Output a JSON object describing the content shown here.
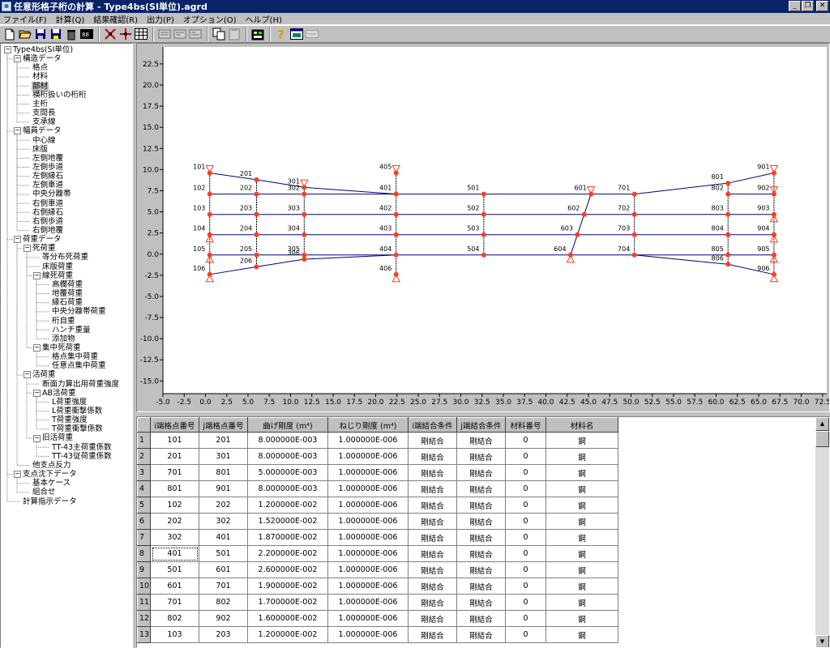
{
  "window": {
    "title": "任意形格子桁の計算 - Type4bs(SI単位).agrd",
    "app_icon": "app-icon",
    "minimize": "_",
    "maximize": "❐",
    "close": "✕"
  },
  "menu": [
    "ファイル(F)",
    "計算(Q)",
    "結果確認(R)",
    "出力(P)",
    "オプション(O)",
    "ヘルプ(H)"
  ],
  "toolbar_icons": [
    "new-file-icon",
    "open-folder-icon",
    "save-icon",
    "save-as-icon",
    "delete-icon",
    "data-table-icon",
    "node-tool-icon",
    "member-tool-icon",
    "grid-view-icon",
    "page-icon-1",
    "page-icon-2",
    "page-icon-3",
    "copy-icon",
    "paste-icon",
    "calculator-icon",
    "help-icon",
    "window-icon",
    "disabled-tool-icon"
  ],
  "tree": [
    {
      "label": "Type4bs(SI単位)",
      "level": 0,
      "expander": "−"
    },
    {
      "label": "構造データ",
      "level": 1,
      "expander": "−"
    },
    {
      "label": "格点",
      "level": 2
    },
    {
      "label": "材料",
      "level": 2
    },
    {
      "label": "部材",
      "level": 2,
      "selected": true
    },
    {
      "label": "横桁扱いの桁桁",
      "level": 2
    },
    {
      "label": "主桁",
      "level": 2
    },
    {
      "label": "支間長",
      "level": 2
    },
    {
      "label": "支承線",
      "level": 2
    },
    {
      "label": "幅員データ",
      "level": 1,
      "expander": "−"
    },
    {
      "label": "中心線",
      "level": 2
    },
    {
      "label": "床版",
      "level": 2
    },
    {
      "label": "左側地覆",
      "level": 2
    },
    {
      "label": "左側歩道",
      "level": 2
    },
    {
      "label": "左側縁石",
      "level": 2
    },
    {
      "label": "左側車道",
      "level": 2
    },
    {
      "label": "中央分離帯",
      "level": 2
    },
    {
      "label": "右側車道",
      "level": 2
    },
    {
      "label": "右側縁石",
      "level": 2
    },
    {
      "label": "右側歩道",
      "level": 2
    },
    {
      "label": "右側地覆",
      "level": 2
    },
    {
      "label": "荷重データ",
      "level": 1,
      "expander": "−"
    },
    {
      "label": "死荷重",
      "level": 2,
      "expander": "−"
    },
    {
      "label": "等分布死荷重",
      "level": 3
    },
    {
      "label": "床版荷重",
      "level": 3
    },
    {
      "label": "線死荷重",
      "level": 3,
      "expander": "−"
    },
    {
      "label": "高欄荷重",
      "level": 4
    },
    {
      "label": "地覆荷重",
      "level": 4
    },
    {
      "label": "縁石荷重",
      "level": 4
    },
    {
      "label": "中央分離帯荷重",
      "level": 4
    },
    {
      "label": "桁自重",
      "level": 4
    },
    {
      "label": "ハンチ重量",
      "level": 4
    },
    {
      "label": "添加物",
      "level": 4
    },
    {
      "label": "集中死荷重",
      "level": 3,
      "expander": "−"
    },
    {
      "label": "格点集中荷重",
      "level": 4
    },
    {
      "label": "任意点集中荷重",
      "level": 4
    },
    {
      "label": "活荷重",
      "level": 2,
      "expander": "−"
    },
    {
      "label": "断面力算出用荷重強度",
      "level": 3
    },
    {
      "label": "AB活荷重",
      "level": 3,
      "expander": "−"
    },
    {
      "label": "L荷重強度",
      "level": 4
    },
    {
      "label": "L荷重衝撃係数",
      "level": 4
    },
    {
      "label": "T荷重強度",
      "level": 4
    },
    {
      "label": "T荷重衝撃係数",
      "level": 4
    },
    {
      "label": "旧活荷重",
      "level": 3,
      "expander": "−"
    },
    {
      "label": "TT-43主荷重係数",
      "level": 4
    },
    {
      "label": "TT-43従荷重係数",
      "level": 4
    },
    {
      "label": "他支点反力",
      "level": 2
    },
    {
      "label": "支点沈下データ",
      "level": 1,
      "expander": "−"
    },
    {
      "label": "基本ケース",
      "level": 2
    },
    {
      "label": "組合せ",
      "level": 2
    },
    {
      "label": "計算指示データ",
      "level": 1
    }
  ],
  "plot": {
    "x_ticks": [
      "-5.0",
      "-2.5",
      "0.0",
      "2.5",
      "5.0",
      "7.5",
      "10.0",
      "12.5",
      "15.0",
      "17.5",
      "20.0",
      "22.5",
      "25.0",
      "27.5",
      "30.0",
      "32.5",
      "35.0",
      "37.5",
      "40.0",
      "42.5",
      "45.0",
      "47.5",
      "50.0",
      "52.5",
      "55.0",
      "57.5",
      "60.0",
      "62.5",
      "65.0",
      "67.5",
      "70.0",
      "72.5"
    ],
    "y_ticks": [
      "22.5",
      "20.0",
      "17.5",
      "15.0",
      "12.5",
      "10.0",
      "7.5",
      "5.0",
      "2.5",
      "0.0",
      "-2.5",
      "-5.0",
      "-7.5",
      "-10.0",
      "-12.5",
      "-15.0"
    ],
    "x_range": [
      -5.0,
      73.0
    ],
    "y_range": [
      -16.5,
      24.5
    ],
    "colors": {
      "background": "#ffffff",
      "grid_line": "#000000",
      "member": "#00007f",
      "node": "#ff3c1e",
      "support": "#ff3c1e",
      "label": "#000000"
    },
    "nodes": [
      {
        "id": "101",
        "x": 0.5,
        "y": 9.6,
        "support": true
      },
      {
        "id": "102",
        "x": 0.5,
        "y": 7.1,
        "support": false
      },
      {
        "id": "103",
        "x": 0.5,
        "y": 4.7,
        "support": false
      },
      {
        "id": "104",
        "x": 0.5,
        "y": 2.3,
        "support": true
      },
      {
        "id": "105",
        "x": 0.5,
        "y": -0.1,
        "support": true
      },
      {
        "id": "106",
        "x": 0.5,
        "y": -2.4,
        "support": true
      },
      {
        "id": "201",
        "x": 6.0,
        "y": 8.8,
        "support": false
      },
      {
        "id": "202",
        "x": 6.0,
        "y": 7.1,
        "support": false
      },
      {
        "id": "203",
        "x": 6.0,
        "y": 4.7,
        "support": false
      },
      {
        "id": "204",
        "x": 6.0,
        "y": 2.3,
        "support": false
      },
      {
        "id": "205",
        "x": 6.0,
        "y": -0.1,
        "support": false
      },
      {
        "id": "206",
        "x": 6.0,
        "y": -1.5,
        "support": false
      },
      {
        "id": "301",
        "x": 11.6,
        "y": 7.9,
        "support": true
      },
      {
        "id": "302",
        "x": 11.6,
        "y": 7.1,
        "support": false
      },
      {
        "id": "303",
        "x": 11.6,
        "y": 4.7,
        "support": false
      },
      {
        "id": "304",
        "x": 11.6,
        "y": 2.3,
        "support": false
      },
      {
        "id": "305",
        "x": 11.6,
        "y": -0.1,
        "support": false
      },
      {
        "id": "306",
        "x": 11.6,
        "y": -0.6,
        "support": false
      },
      {
        "id": "405",
        "x": 22.4,
        "y": 9.6,
        "support": true
      },
      {
        "id": "401",
        "x": 22.4,
        "y": 7.1,
        "support": false
      },
      {
        "id": "402",
        "x": 22.4,
        "y": 4.7,
        "support": false
      },
      {
        "id": "403",
        "x": 22.4,
        "y": 2.3,
        "support": false
      },
      {
        "id": "404",
        "x": 22.4,
        "y": -0.1,
        "support": false
      },
      {
        "id": "406",
        "x": 22.4,
        "y": -2.4,
        "support": true
      },
      {
        "id": "501",
        "x": 32.7,
        "y": 7.1,
        "support": false
      },
      {
        "id": "502",
        "x": 32.7,
        "y": 4.7,
        "support": false
      },
      {
        "id": "503",
        "x": 32.7,
        "y": 2.3,
        "support": false
      },
      {
        "id": "504",
        "x": 32.7,
        "y": -0.1,
        "support": false
      },
      {
        "id": "601",
        "x": 45.3,
        "y": 7.1,
        "support": true
      },
      {
        "id": "602",
        "x": 44.5,
        "y": 4.7,
        "support": false
      },
      {
        "id": "603",
        "x": 43.7,
        "y": 2.3,
        "support": false
      },
      {
        "id": "604",
        "x": 42.9,
        "y": -0.1,
        "support": true
      },
      {
        "id": "701",
        "x": 50.4,
        "y": 7.1,
        "support": false
      },
      {
        "id": "702",
        "x": 50.4,
        "y": 4.7,
        "support": false
      },
      {
        "id": "703",
        "x": 50.4,
        "y": 2.3,
        "support": false
      },
      {
        "id": "704",
        "x": 50.4,
        "y": -0.1,
        "support": false
      },
      {
        "id": "801",
        "x": 61.4,
        "y": 8.4,
        "support": false
      },
      {
        "id": "802",
        "x": 61.4,
        "y": 7.1,
        "support": false
      },
      {
        "id": "803",
        "x": 61.4,
        "y": 4.7,
        "support": false
      },
      {
        "id": "804",
        "x": 61.4,
        "y": 2.3,
        "support": false
      },
      {
        "id": "805",
        "x": 61.4,
        "y": -0.1,
        "support": false
      },
      {
        "id": "806",
        "x": 61.4,
        "y": -1.2,
        "support": false
      },
      {
        "id": "901",
        "x": 66.8,
        "y": 9.6,
        "support": true
      },
      {
        "id": "902",
        "x": 66.8,
        "y": 7.1,
        "support": true
      },
      {
        "id": "903",
        "x": 66.8,
        "y": 4.7,
        "support": true
      },
      {
        "id": "904",
        "x": 66.8,
        "y": 2.3,
        "support": true
      },
      {
        "id": "905",
        "x": 66.8,
        "y": -0.1,
        "support": true
      },
      {
        "id": "906",
        "x": 66.8,
        "y": -2.4,
        "support": true
      }
    ],
    "members": [
      [
        "101",
        "201"
      ],
      [
        "201",
        "301"
      ],
      [
        "301",
        "401"
      ],
      [
        "401",
        "501"
      ],
      [
        "501",
        "601"
      ],
      [
        "601",
        "701"
      ],
      [
        "701",
        "801"
      ],
      [
        "801",
        "901"
      ],
      [
        "102",
        "202"
      ],
      [
        "202",
        "302"
      ],
      [
        "302",
        "401"
      ],
      [
        "103",
        "203"
      ],
      [
        "203",
        "303"
      ],
      [
        "303",
        "402"
      ],
      [
        "402",
        "502"
      ],
      [
        "502",
        "602"
      ],
      [
        "602",
        "702"
      ],
      [
        "702",
        "803"
      ],
      [
        "803",
        "903"
      ],
      [
        "104",
        "204"
      ],
      [
        "204",
        "304"
      ],
      [
        "304",
        "403"
      ],
      [
        "403",
        "503"
      ],
      [
        "503",
        "603"
      ],
      [
        "603",
        "703"
      ],
      [
        "703",
        "804"
      ],
      [
        "804",
        "904"
      ],
      [
        "105",
        "205"
      ],
      [
        "205",
        "305"
      ],
      [
        "305",
        "404"
      ],
      [
        "404",
        "504"
      ],
      [
        "504",
        "604"
      ],
      [
        "604",
        "704"
      ],
      [
        "704",
        "805"
      ],
      [
        "805",
        "905"
      ],
      [
        "106",
        "206"
      ],
      [
        "206",
        "306"
      ],
      [
        "306",
        "404"
      ],
      [
        "704",
        "806"
      ],
      [
        "806",
        "906"
      ],
      [
        "802",
        "902"
      ],
      [
        "101",
        "106"
      ],
      [
        "201",
        "206"
      ],
      [
        "301",
        "306"
      ],
      [
        "405",
        "406"
      ],
      [
        "501",
        "504"
      ],
      [
        "601",
        "604"
      ],
      [
        "701",
        "704"
      ],
      [
        "801",
        "806"
      ],
      [
        "901",
        "906"
      ]
    ]
  },
  "table": {
    "headers": [
      "",
      "i端格点番号",
      "j端格点番号",
      "曲げ剛度 (m⁴)",
      "ねじり剛度 (m⁴)",
      "i端結合条件",
      "j端結合条件",
      "材料番号",
      "材料名"
    ],
    "rows": [
      [
        "1",
        "101",
        "201",
        "8.000000E-003",
        "1.000000E-006",
        "剛結合",
        "剛結合",
        "0",
        "鋼"
      ],
      [
        "2",
        "201",
        "301",
        "8.000000E-003",
        "1.000000E-006",
        "剛結合",
        "剛結合",
        "0",
        "鋼"
      ],
      [
        "3",
        "701",
        "801",
        "5.000000E-003",
        "1.000000E-006",
        "剛結合",
        "剛結合",
        "0",
        "鋼"
      ],
      [
        "4",
        "801",
        "901",
        "8.000000E-003",
        "1.000000E-006",
        "剛結合",
        "剛結合",
        "0",
        "鋼"
      ],
      [
        "5",
        "102",
        "202",
        "1.200000E-002",
        "1.000000E-006",
        "剛結合",
        "剛結合",
        "0",
        "鋼"
      ],
      [
        "6",
        "202",
        "302",
        "1.520000E-002",
        "1.000000E-006",
        "剛結合",
        "剛結合",
        "0",
        "鋼"
      ],
      [
        "7",
        "302",
        "401",
        "1.870000E-002",
        "1.000000E-006",
        "剛結合",
        "剛結合",
        "0",
        "鋼"
      ],
      [
        "8",
        "401",
        "501",
        "2.200000E-002",
        "1.000000E-006",
        "剛結合",
        "剛結合",
        "0",
        "鋼"
      ],
      [
        "9",
        "501",
        "601",
        "2.600000E-002",
        "1.000000E-006",
        "剛結合",
        "剛結合",
        "0",
        "鋼"
      ],
      [
        "10",
        "601",
        "701",
        "1.900000E-002",
        "1.000000E-006",
        "剛結合",
        "剛結合",
        "0",
        "鋼"
      ],
      [
        "11",
        "701",
        "802",
        "1.700000E-002",
        "1.000000E-006",
        "剛結合",
        "剛結合",
        "0",
        "鋼"
      ],
      [
        "12",
        "802",
        "902",
        "1.600000E-002",
        "1.000000E-006",
        "剛結合",
        "剛結合",
        "0",
        "鋼"
      ],
      [
        "13",
        "103",
        "203",
        "1.200000E-002",
        "1.000000E-006",
        "剛結合",
        "剛結合",
        "0",
        "鋼"
      ]
    ],
    "focused_row": 7,
    "focused_col": 1
  },
  "scrollbar": {
    "up": "▲",
    "down": "▼"
  }
}
